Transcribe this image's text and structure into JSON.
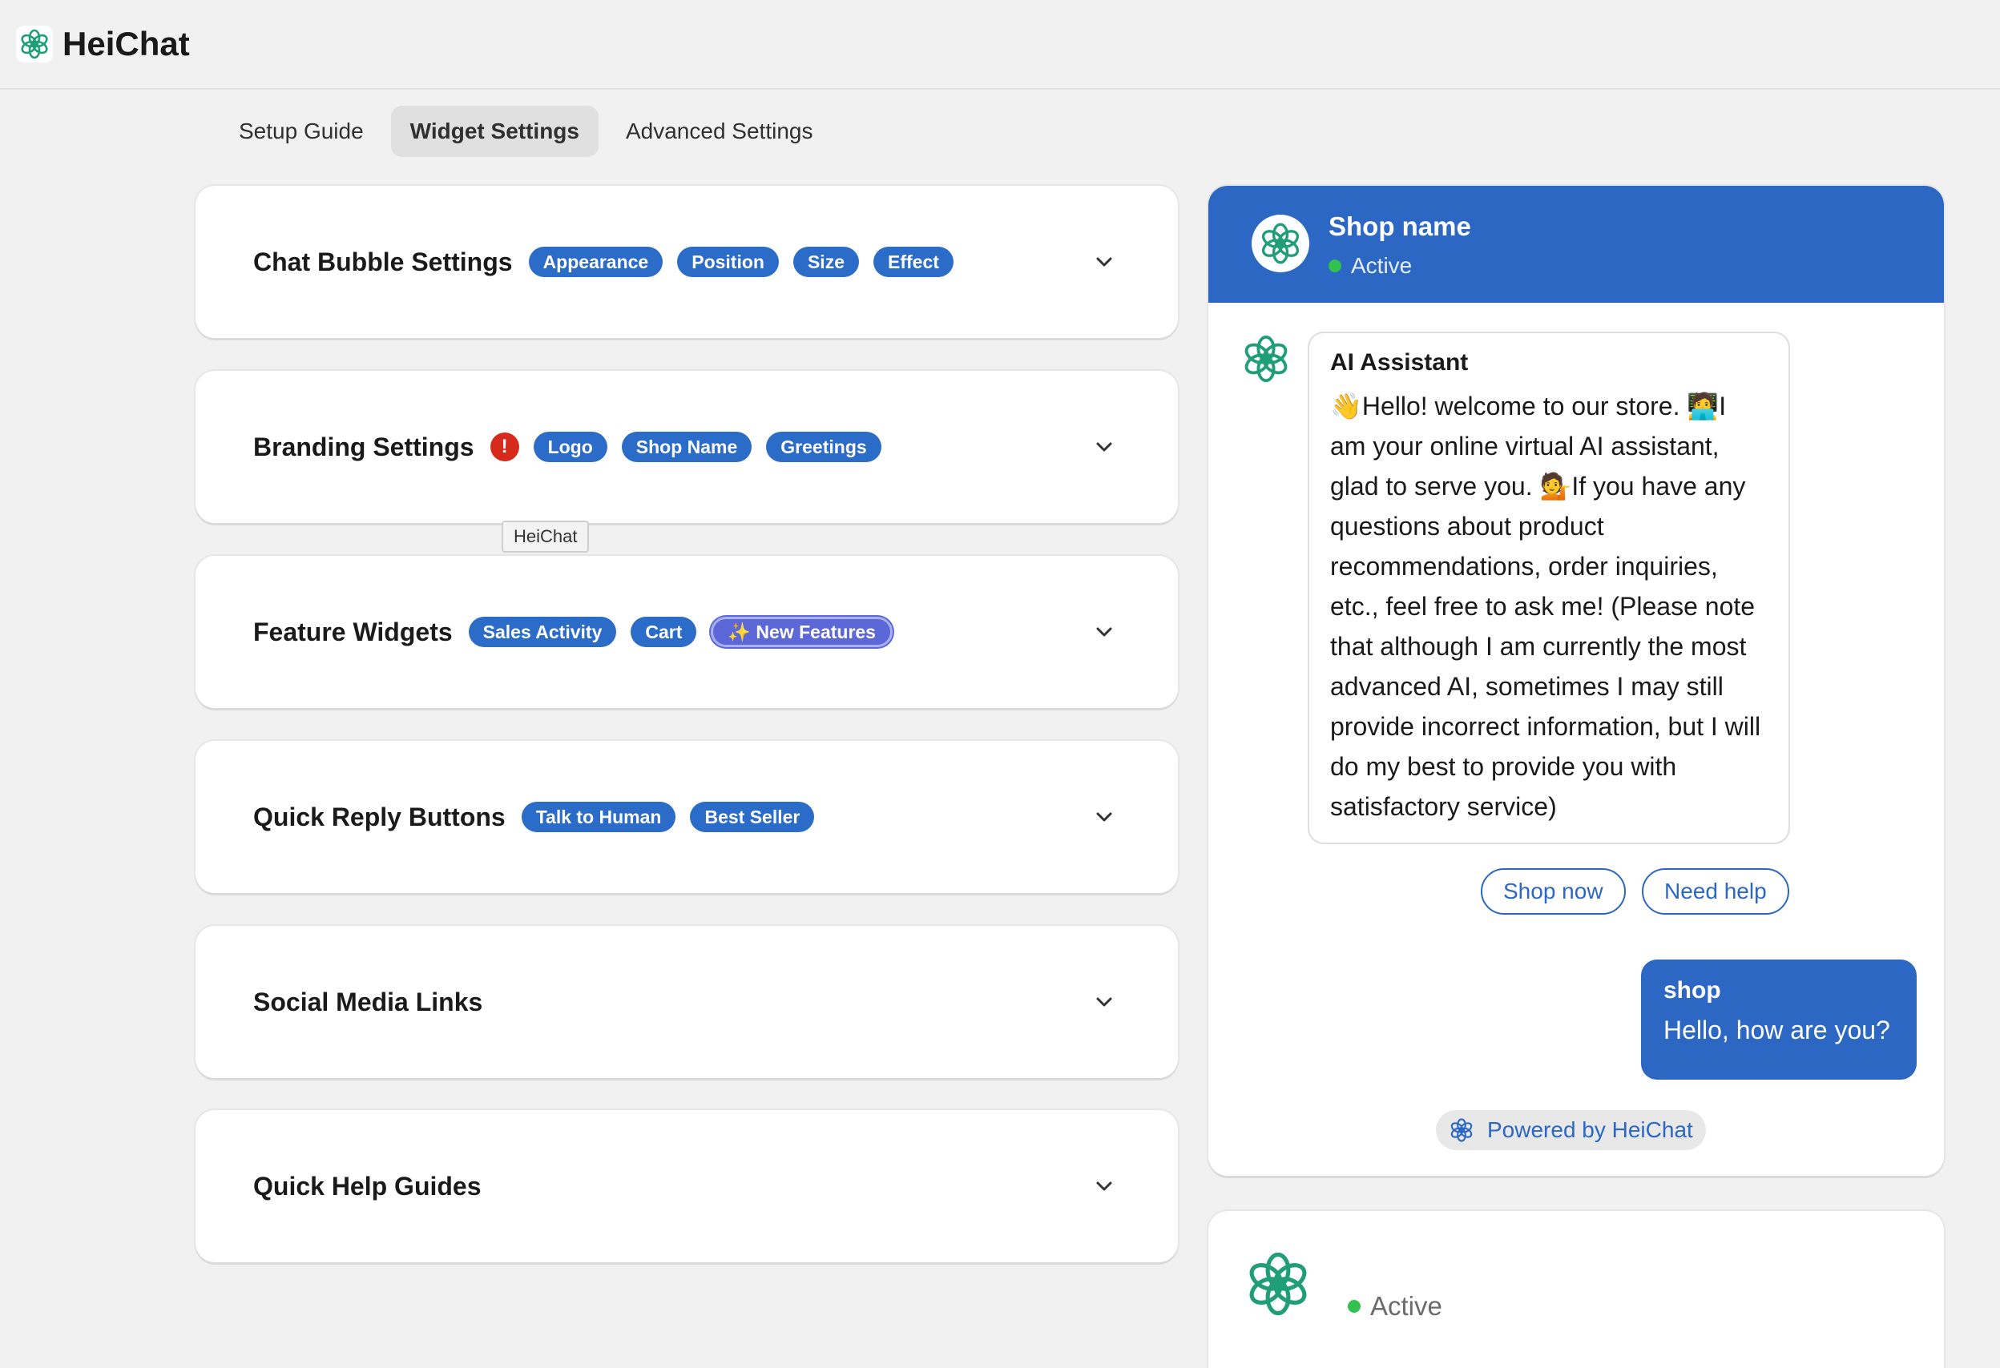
{
  "app": {
    "title": "HeiChat"
  },
  "tabs": [
    {
      "label": "Setup Guide",
      "active": false
    },
    {
      "label": "Widget Settings",
      "active": true
    },
    {
      "label": "Advanced Settings",
      "active": false
    }
  ],
  "sections": [
    {
      "title": "Chat Bubble Settings",
      "tags": [
        "Appearance",
        "Position",
        "Size",
        "Effect"
      ]
    },
    {
      "title": "Branding Settings",
      "alert": "!",
      "tags": [
        "Logo",
        "Shop Name",
        "Greetings"
      ]
    },
    {
      "title": "Feature Widgets",
      "tags": [
        "Sales Activity",
        "Cart"
      ],
      "new_tag": "✨ New Features"
    },
    {
      "title": "Quick Reply Buttons",
      "tags": [
        "Talk to Human",
        "Best Seller"
      ]
    },
    {
      "title": "Social Media Links",
      "tags": []
    },
    {
      "title": "Quick Help Guides",
      "tags": []
    }
  ],
  "tooltip": "HeiChat",
  "preview": {
    "shop_name": "Shop name",
    "status": "Active",
    "bot_name": "AI Assistant",
    "bot_message": "👋Hello! welcome to our store. 🧑‍💻I am your online virtual AI assistant, glad to serve you. 💁If you have any questions about product recommendations, order inquiries, etc., feel free to ask me! (Please note that although I am currently the most advanced AI, sometimes I may still provide incorrect information, but I will do my best to provide you with satisfactory service)",
    "quick_buttons": [
      "Shop now",
      "Need help"
    ],
    "user_name": "shop",
    "user_message": "Hello, how are you?",
    "powered_by": "Powered by HeiChat"
  },
  "preview2": {
    "status": "Active"
  },
  "colors": {
    "accent": "#2c67c3",
    "pill": "#2b6cc8",
    "alert": "#d62a1c",
    "online": "#31c24d",
    "logo": "#1f9e78"
  }
}
